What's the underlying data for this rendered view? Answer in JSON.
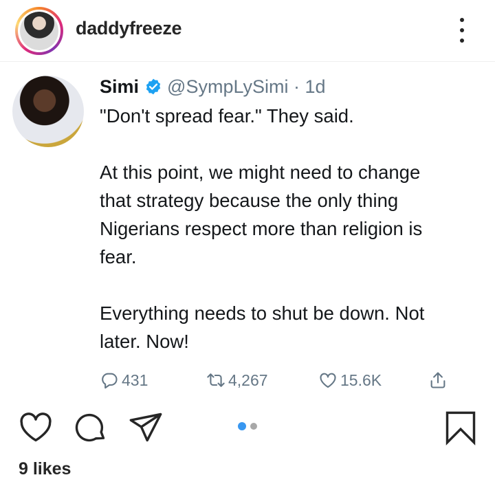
{
  "post": {
    "username": "daddyfreeze",
    "avatar_icon": "profile-photo",
    "more_icon": "more-options-icon"
  },
  "tweet": {
    "name": "Simi",
    "verified_icon": "verified-badge-icon",
    "handle": "@SympLySimi · 1d",
    "lines": [
      "\"Don't spread fear.\" They said.",
      "",
      "At this point, we might need to change",
      "that strategy because the only thing",
      "Nigerians respect more than religion is",
      "fear.",
      "",
      "Everything needs to shut be down. Not",
      "later. Now!"
    ],
    "actions": {
      "replies": "431",
      "retweets": "4,267",
      "likes": "15.6K"
    },
    "colors": {
      "verified": "#1da1f2",
      "muted": "#657786",
      "text": "#14171a"
    }
  },
  "ig_actions": {
    "like_icon": "heart-icon",
    "comment_icon": "comment-icon",
    "share_icon": "send-icon",
    "save_icon": "bookmark-icon",
    "carousel": {
      "count": 2,
      "active": 1,
      "active_color": "#3897f0",
      "inactive_color": "#a8a8a8"
    }
  },
  "likes_text": "9 likes"
}
